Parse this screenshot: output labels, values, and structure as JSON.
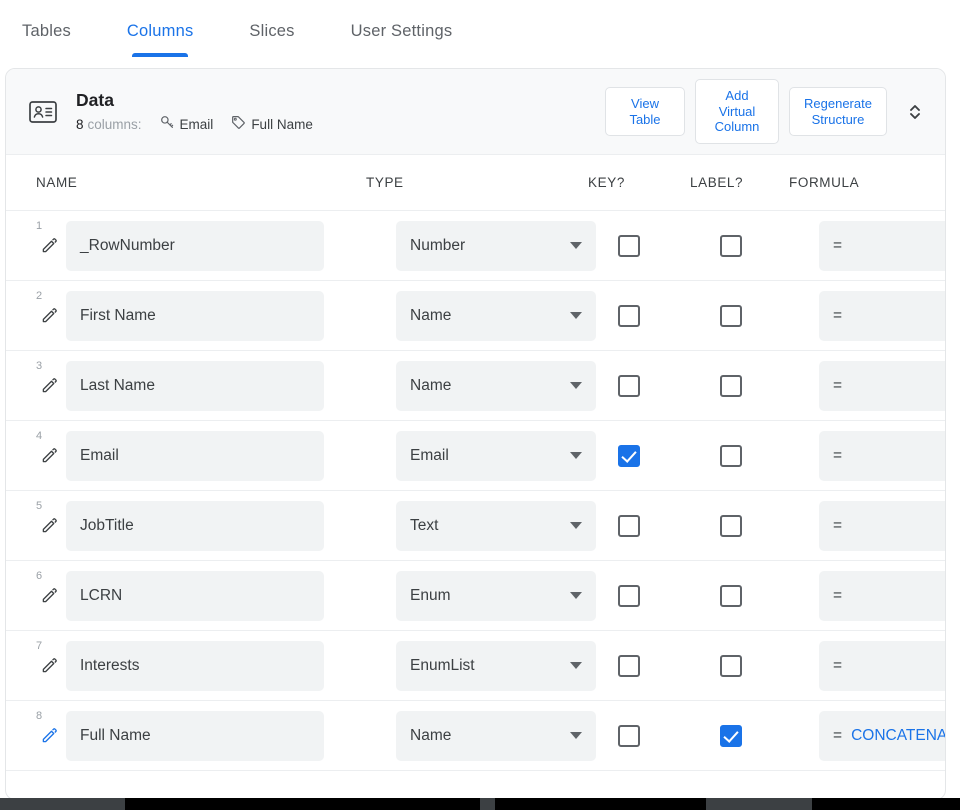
{
  "tabs": [
    {
      "label": "Tables",
      "active": false
    },
    {
      "label": "Columns",
      "active": true
    },
    {
      "label": "Slices",
      "active": false
    },
    {
      "label": "User Settings",
      "active": false
    }
  ],
  "card_header": {
    "icon": "contact-card-icon",
    "title": "Data",
    "column_count": "8",
    "columns_label": "columns:",
    "key_chip": {
      "icon": "key-icon",
      "label": "Email"
    },
    "label_chip": {
      "icon": "tag-icon",
      "label": "Full Name"
    },
    "buttons": [
      {
        "name": "view-table-button",
        "label": "View\nTable"
      },
      {
        "name": "add-virtual-column-button",
        "label": "Add\nVirtual\nColumn"
      },
      {
        "name": "regenerate-structure-button",
        "label": "Regenerate\nStructure"
      }
    ],
    "expander_icon": "unfold-more-icon"
  },
  "table": {
    "headers": {
      "name": "NAME",
      "type": "TYPE",
      "key": "KEY?",
      "label": "LABEL?",
      "formula": "FORMULA"
    },
    "rows": [
      {
        "num": "1",
        "name": "_RowNumber",
        "type": "Number",
        "key": false,
        "label": false,
        "formula_eq": "=",
        "formula_text": "",
        "virtual": false
      },
      {
        "num": "2",
        "name": "First Name",
        "type": "Name",
        "key": false,
        "label": false,
        "formula_eq": "=",
        "formula_text": "",
        "virtual": false
      },
      {
        "num": "3",
        "name": "Last Name",
        "type": "Name",
        "key": false,
        "label": false,
        "formula_eq": "=",
        "formula_text": "",
        "virtual": false
      },
      {
        "num": "4",
        "name": "Email",
        "type": "Email",
        "key": true,
        "label": false,
        "formula_eq": "=",
        "formula_text": "",
        "virtual": false
      },
      {
        "num": "5",
        "name": "JobTitle",
        "type": "Text",
        "key": false,
        "label": false,
        "formula_eq": "=",
        "formula_text": "",
        "virtual": false
      },
      {
        "num": "6",
        "name": "LCRN",
        "type": "Enum",
        "key": false,
        "label": false,
        "formula_eq": "=",
        "formula_text": "",
        "virtual": false
      },
      {
        "num": "7",
        "name": "Interests",
        "type": "EnumList",
        "key": false,
        "label": false,
        "formula_eq": "=",
        "formula_text": "",
        "virtual": false
      },
      {
        "num": "8",
        "name": "Full Name",
        "type": "Name",
        "key": false,
        "label": true,
        "formula_eq": "=",
        "formula_text": "CONCATENA",
        "virtual": true
      }
    ]
  },
  "colors": {
    "accent": "#1a73e8",
    "field_bg": "#f1f3f4",
    "header_bg": "#f8f9fa",
    "text": "#3c4043",
    "muted": "#9aa0a6"
  }
}
